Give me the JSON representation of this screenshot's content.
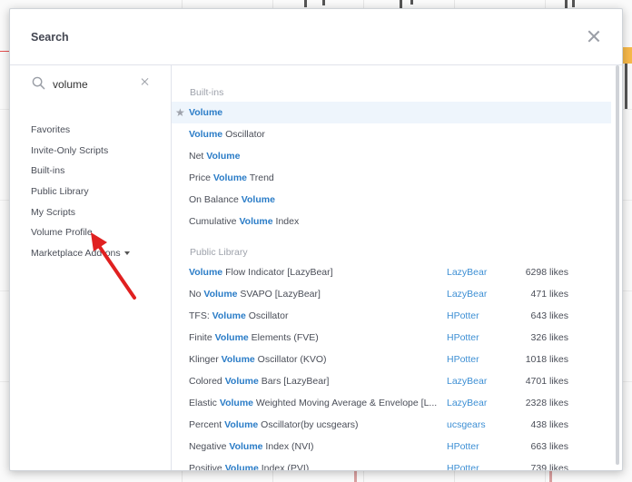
{
  "dialog": {
    "title": "Search"
  },
  "search": {
    "value": "volume",
    "placeholder": ""
  },
  "categories": [
    {
      "label": "Favorites"
    },
    {
      "label": "Invite-Only Scripts"
    },
    {
      "label": "Built-ins"
    },
    {
      "label": "Public Library"
    },
    {
      "label": "My Scripts"
    },
    {
      "label": "Volume Profile"
    },
    {
      "label": "Marketplace Add-ons"
    }
  ],
  "sections": {
    "builtins": "Built-ins",
    "public_library": "Public Library"
  },
  "builtins": [
    {
      "pre": "",
      "hl": "Volume",
      "post": ""
    },
    {
      "pre": "",
      "hl": "Volume",
      "post": " Oscillator"
    },
    {
      "pre": "Net ",
      "hl": "Volume",
      "post": ""
    },
    {
      "pre": "Price ",
      "hl": "Volume",
      "post": " Trend"
    },
    {
      "pre": "On Balance ",
      "hl": "Volume",
      "post": ""
    },
    {
      "pre": "Cumulative ",
      "hl": "Volume",
      "post": " Index"
    }
  ],
  "library": [
    {
      "pre": "",
      "hl": "Volume",
      "post": " Flow Indicator [LazyBear]",
      "author": "LazyBear",
      "likes": "6298 likes"
    },
    {
      "pre": "No ",
      "hl": "Volume",
      "post": " SVAPO [LazyBear]",
      "author": "LazyBear",
      "likes": "471 likes"
    },
    {
      "pre": "TFS: ",
      "hl": "Volume",
      "post": " Oscillator",
      "author": "HPotter",
      "likes": "643 likes"
    },
    {
      "pre": "Finite ",
      "hl": "Volume",
      "post": " Elements (FVE)",
      "author": "HPotter",
      "likes": "326 likes"
    },
    {
      "pre": "Klinger ",
      "hl": "Volume",
      "post": " Oscillator (KVO)",
      "author": "HPotter",
      "likes": "1018 likes"
    },
    {
      "pre": "Colored ",
      "hl": "Volume",
      "post": " Bars [LazyBear]",
      "author": "LazyBear",
      "likes": "4701 likes"
    },
    {
      "pre": "Elastic ",
      "hl": "Volume",
      "post": " Weighted Moving Average & Envelope [L...",
      "author": "LazyBear",
      "likes": "2328 likes"
    },
    {
      "pre": "Percent ",
      "hl": "Volume",
      "post": " Oscillator(by ucsgears)",
      "author": "ucsgears",
      "likes": "438 likes"
    },
    {
      "pre": "Negative ",
      "hl": "Volume",
      "post": " Index (NVI)",
      "author": "HPotter",
      "likes": "663 likes"
    },
    {
      "pre": "Positive ",
      "hl": "Volume",
      "post": " Index (PVI)",
      "author": "HPotter",
      "likes": "739 likes"
    }
  ],
  "colors": {
    "highlight": "#2a7cc7",
    "author_link": "#3d8fd4",
    "annotation_arrow": "#e02020"
  }
}
